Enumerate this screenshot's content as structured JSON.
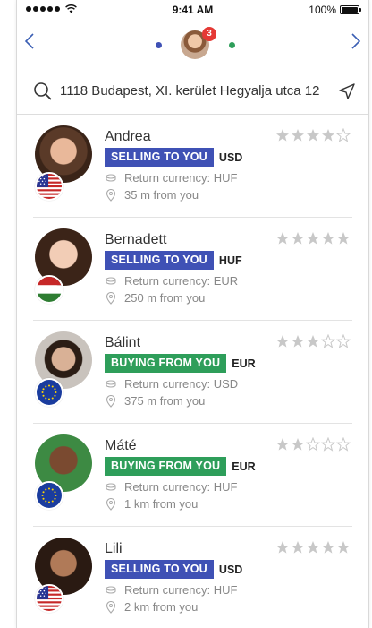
{
  "status_bar": {
    "time": "9:41 AM",
    "battery": "100%"
  },
  "nav": {
    "notification_count": "3",
    "dot_left_color": "#3f51b5",
    "dot_right_color": "#2e9e5a"
  },
  "search": {
    "value": "1118 Budapest, XI. kerület Hegyalja utca 12",
    "placeholder": ""
  },
  "colors": {
    "accent_blue": "#3b5fb4",
    "selling": "#3f51b5",
    "buying": "#2e9e5a",
    "star_filled": "#c8c8c8"
  },
  "items": [
    {
      "name": "Andrea",
      "tag": "SELLING TO YOU",
      "tag_type": "selling",
      "currency": "USD",
      "return_currency": "Return currency: HUF",
      "distance": "35 m from you",
      "rating": 4,
      "flag": "us"
    },
    {
      "name": "Bernadett",
      "tag": "SELLING TO YOU",
      "tag_type": "selling",
      "currency": "HUF",
      "return_currency": "Return currency: EUR",
      "distance": "250 m from you",
      "rating": 5,
      "flag": "hu"
    },
    {
      "name": "Bálint",
      "tag": "BUYING FROM YOU",
      "tag_type": "buying",
      "currency": "EUR",
      "return_currency": "Return currency: USD",
      "distance": "375 m from you",
      "rating": 3,
      "flag": "eu"
    },
    {
      "name": "Máté",
      "tag": "BUYING FROM YOU",
      "tag_type": "buying",
      "currency": "EUR",
      "return_currency": "Return currency: HUF",
      "distance": "1 km from you",
      "rating": 2,
      "flag": "eu"
    },
    {
      "name": "Lili",
      "tag": "SELLING TO YOU",
      "tag_type": "selling",
      "currency": "USD",
      "return_currency": "Return currency: HUF",
      "distance": "2 km from you",
      "rating": 5,
      "flag": "us"
    }
  ]
}
